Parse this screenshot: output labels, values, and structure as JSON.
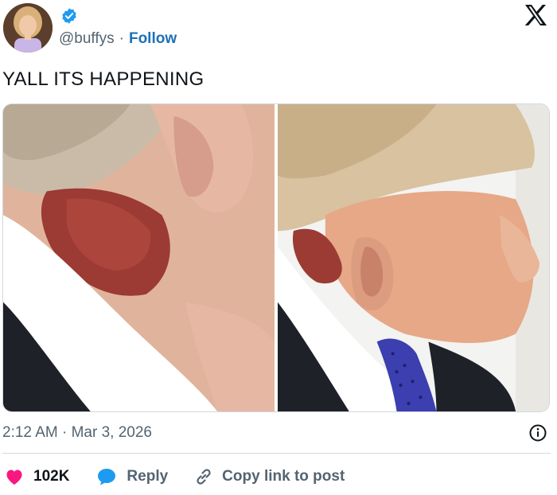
{
  "header": {
    "handle": "@buffys",
    "separator": "·",
    "follow_label": "Follow"
  },
  "tweet": {
    "text": "YALL ITS HAPPENING",
    "timestamp": "2:12 AM · Mar 3, 2026"
  },
  "actions": {
    "likes": "102K",
    "reply_label": "Reply",
    "copy_label": "Copy link to post"
  },
  "colors": {
    "link": "#1d70b8",
    "secondary_text": "#536471",
    "like": "#f91880",
    "reply": "#1d9bf0",
    "verified": "#1d9bf0"
  },
  "icons": [
    "avatar",
    "verified-badge-icon",
    "x-logo-icon",
    "info-icon",
    "heart-icon",
    "reply-bubble-icon",
    "link-icon"
  ]
}
